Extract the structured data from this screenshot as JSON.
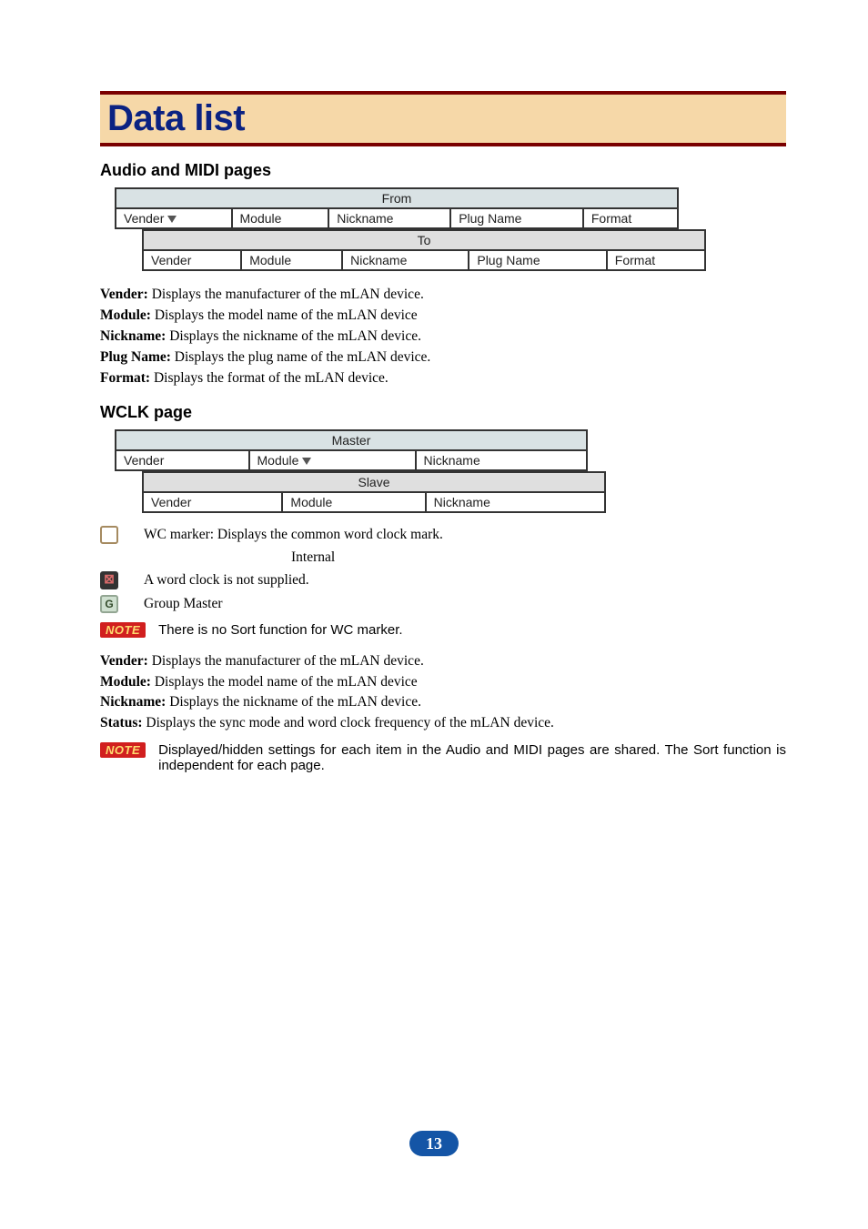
{
  "title": "Data list",
  "sections": {
    "audio_midi": {
      "heading": "Audio and MIDI pages",
      "from_label": "From",
      "to_label": "To",
      "from_cols": [
        "Vender",
        "Module",
        "Nickname",
        "Plug Name",
        "Format"
      ],
      "to_cols": [
        "Vender",
        "Module",
        "Nickname",
        "Plug Name",
        "Format"
      ],
      "defs": [
        {
          "term": "Vender:",
          "desc": "Displays the manufacturer of the mLAN device."
        },
        {
          "term": "Module:",
          "desc": "Displays the model name of the mLAN device"
        },
        {
          "term": "Nickname:",
          "desc": "Displays the nickname of the mLAN device."
        },
        {
          "term": "Plug Name:",
          "desc": "Displays the plug name of the mLAN device."
        },
        {
          "term": "Format:",
          "desc": "Displays the format of the mLAN device."
        }
      ]
    },
    "wclk": {
      "heading": "WCLK page",
      "master_label": "Master",
      "slave_label": "Slave",
      "master_cols": [
        "Vender",
        "Module",
        "Nickname"
      ],
      "slave_cols": [
        "Vender",
        "Module",
        "Nickname"
      ],
      "legend": {
        "wc_marker": "WC marker: Displays the common word clock mark.",
        "internal": "Internal",
        "not_supplied": "A word clock is not supplied.",
        "group_master": "Group Master"
      },
      "note1": "There is no Sort function for WC marker.",
      "defs": [
        {
          "term": "Vender:",
          "desc": "Displays the manufacturer of the mLAN device."
        },
        {
          "term": "Module:",
          "desc": "Displays the model name of the mLAN device"
        },
        {
          "term": "Nickname:",
          "desc": "Displays the nickname of the mLAN device."
        },
        {
          "term": "Status:",
          "desc": "Displays the sync mode and word clock frequency of the mLAN device."
        }
      ],
      "note2": "Displayed/hidden settings for each item in the Audio and MIDI pages are shared. The Sort function is independent for each page."
    }
  },
  "note_label": "NOTE",
  "page_number": "13",
  "icons": {
    "cross": "⊠",
    "g": "G"
  }
}
